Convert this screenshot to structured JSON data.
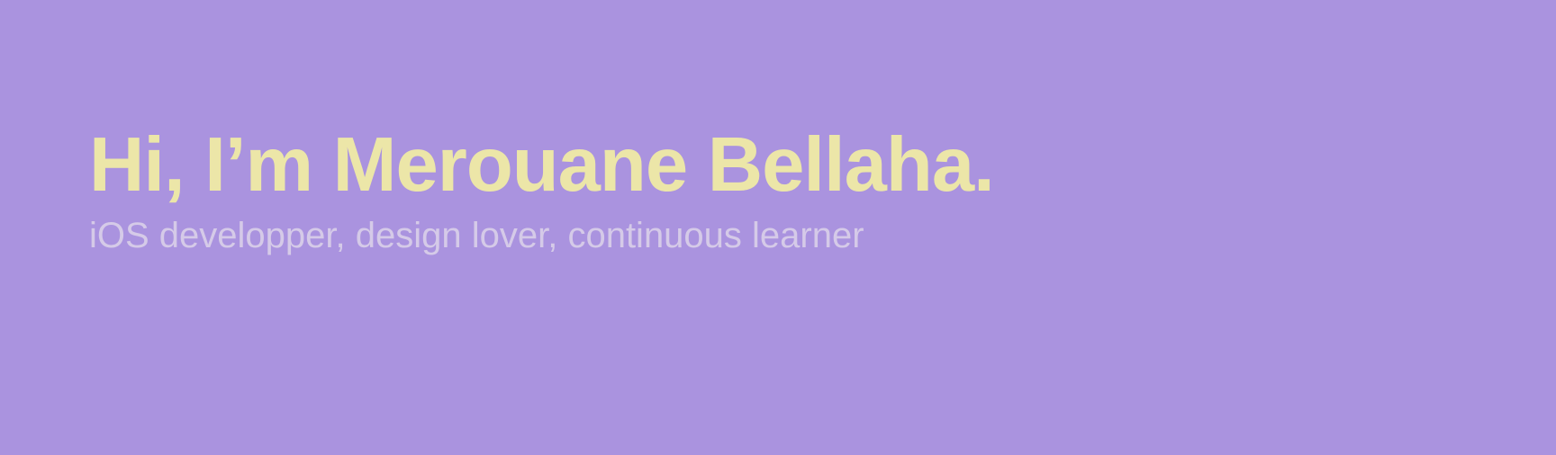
{
  "hero": {
    "title": "Hi, I’m Merouane Bellaha.",
    "subtitle": "iOS developper, design lover, continuous learner"
  },
  "colors": {
    "background": "#aa93df",
    "title": "#ece6a8",
    "subtitle": "#d5cae8"
  }
}
